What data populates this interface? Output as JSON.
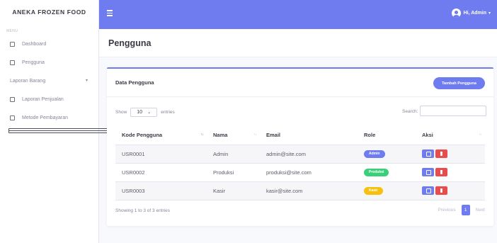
{
  "brand": "ANEKA FROZEN FOOD",
  "sidebar": {
    "heading": "MENU",
    "items": [
      {
        "label": "Dashboard"
      },
      {
        "label": "Pengguna"
      },
      {
        "label": "Laporan Barang"
      },
      {
        "label": "Laporan Penjualan"
      },
      {
        "label": "Metode Pembayaran"
      }
    ]
  },
  "topbar": {
    "user": "Hi, Admin"
  },
  "page": {
    "title": "Pengguna"
  },
  "card": {
    "title": "Data Pengguna",
    "add_button": "Tambah Pengguna"
  },
  "controls": {
    "show_label": "Show",
    "length_value": "10",
    "entries_label": "entries",
    "search_label": "Search:",
    "search_value": ""
  },
  "table": {
    "columns": [
      "Kode Pengguna",
      "Nama",
      "Email",
      "Role",
      "Aksi"
    ],
    "rows": [
      {
        "kode": "USR0001",
        "nama": "Admin",
        "email": "admin@site.com",
        "role": "Admin",
        "role_color": "#6f7cf0"
      },
      {
        "kode": "USR0002",
        "nama": "Produksi",
        "email": "produksi@site.com",
        "role": "Produksi",
        "role_color": "#3ad07a"
      },
      {
        "kode": "USR0003",
        "nama": "Kasir",
        "email": "kasir@site.com",
        "role": "Kasir",
        "role_color": "#f6c10e"
      }
    ]
  },
  "footer": {
    "info": "Showing 1 to 3 of 3 entries",
    "previous": "Previous",
    "page": "1",
    "next": "Next"
  },
  "colors": {
    "accent": "#6f7cf0",
    "danger": "#ea4c4c"
  }
}
